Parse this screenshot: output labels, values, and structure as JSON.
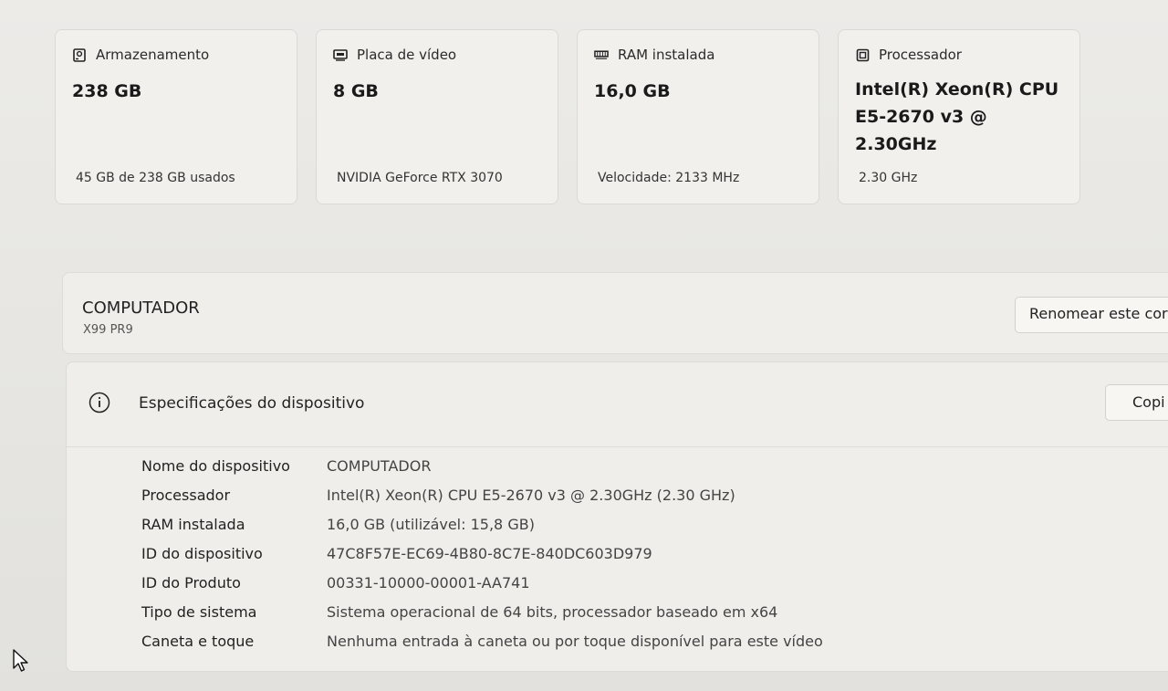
{
  "cards": [
    {
      "icon": "storage-icon",
      "title": "Armazenamento",
      "value": "238 GB",
      "sub": "45 GB de 238 GB usados"
    },
    {
      "icon": "gpu-icon",
      "title": "Placa de vídeo",
      "value": "8 GB",
      "sub": "NVIDIA GeForce RTX 3070"
    },
    {
      "icon": "ram-icon",
      "title": "RAM instalada",
      "value": "16,0 GB",
      "sub": "Velocidade: 2133 MHz"
    },
    {
      "icon": "cpu-icon",
      "title": "Processador",
      "value_line1": "Intel(R) Xeon(R) CPU",
      "value_line2": "E5-2670 v3 @ 2.30GHz",
      "sub": "2.30 GHz"
    }
  ],
  "computer": {
    "name": "COMPUTADOR",
    "model": "X99 PR9",
    "rename_label": "Renomear este cor"
  },
  "specs": {
    "title": "Especificações do dispositivo",
    "copy_label": "Copi",
    "rows": [
      {
        "key": "Nome do dispositivo",
        "value": "COMPUTADOR"
      },
      {
        "key": "Processador",
        "value": "Intel(R) Xeon(R) CPU E5-2670 v3 @ 2.30GHz (2.30 GHz)"
      },
      {
        "key": "RAM instalada",
        "value": "16,0 GB (utilizável: 15,8 GB)"
      },
      {
        "key": "ID do dispositivo",
        "value": "47C8F57E-EC69-4B80-8C7E-840DC603D979"
      },
      {
        "key": "ID do Produto",
        "value": "00331-10000-00001-AA741"
      },
      {
        "key": "Tipo de sistema",
        "value": "Sistema operacional de 64 bits, processador baseado em x64"
      },
      {
        "key": "Caneta e toque",
        "value": "Nenhuma entrada à caneta ou por toque disponível para este vídeo"
      }
    ]
  }
}
